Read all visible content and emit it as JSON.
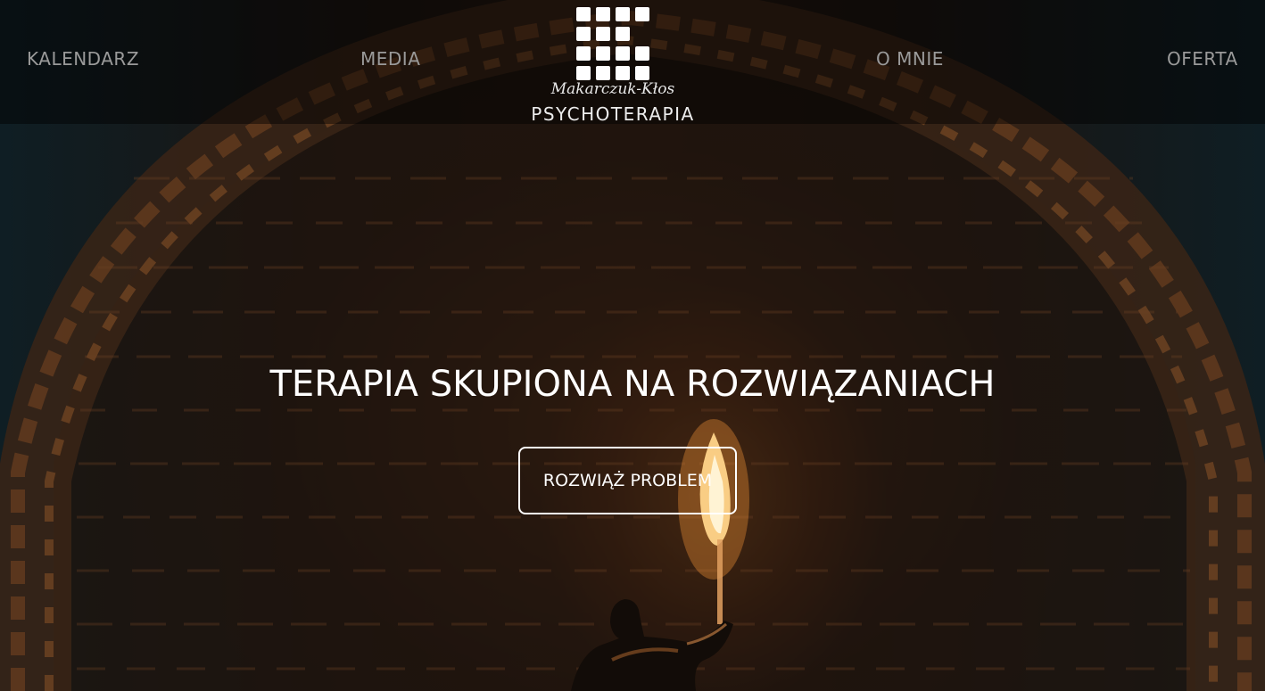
{
  "nav": {
    "items": [
      {
        "label": "KALENDARZ"
      },
      {
        "label": "MEDIA"
      },
      {
        "label": "O MNIE"
      },
      {
        "label": "OFERTA"
      }
    ]
  },
  "logo": {
    "script_text": "Makarczuk-Kłos",
    "wordmark": "PSYCHOTERAPIA"
  },
  "hero": {
    "headline": "TERAPIA SKUPIONA NA ROZWIĄZANIACH",
    "cta_label": "ROZWIĄŻ PROBLEM"
  },
  "colors": {
    "nav_text": "#9a9a9a",
    "accent_text": "#ffffff",
    "torch_glow": "#ff8c28"
  }
}
